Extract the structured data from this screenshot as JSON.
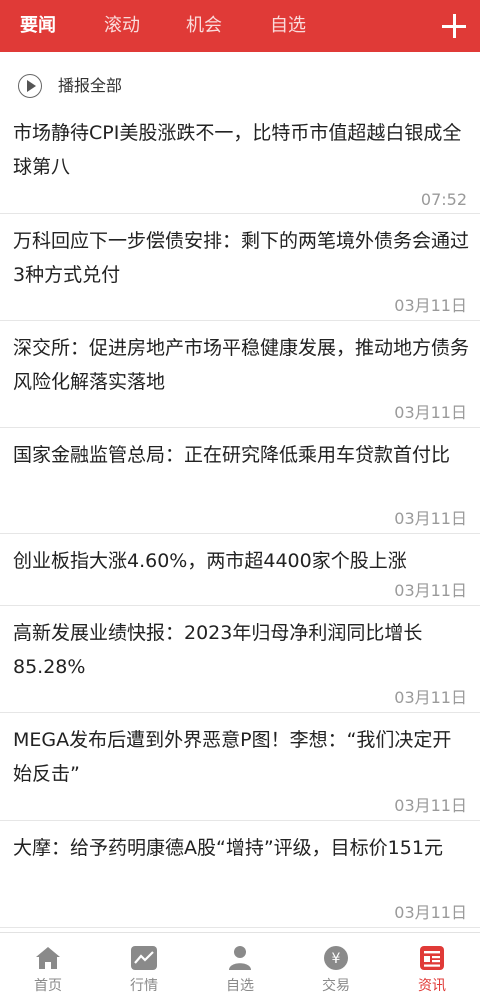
{
  "header": {
    "tabs": [
      {
        "label": "要闻",
        "active": true
      },
      {
        "label": "滚动",
        "active": false
      },
      {
        "label": "机会",
        "active": false
      },
      {
        "label": "自选",
        "active": false
      }
    ],
    "add_icon": "plus-icon"
  },
  "broadcast": {
    "icon": "play-icon",
    "label": "播报全部"
  },
  "news": [
    {
      "title": "市场静待CPI美股涨跌不一，比特币市值超越白银成全球第八",
      "time": "07:52"
    },
    {
      "title": "万科回应下一步偿债安排：剩下的两笔境外债务会通过3种方式兑付",
      "time": "03月11日"
    },
    {
      "title": "深交所：促进房地产市场平稳健康发展，推动地方债务风险化解落实落地",
      "time": "03月11日"
    },
    {
      "title": "国家金融监管总局：正在研究降低乘用车贷款首付比",
      "time": "03月11日"
    },
    {
      "title": "创业板指大涨4.60%，两市超4400家个股上涨",
      "time": "03月11日"
    },
    {
      "title": "高新发展业绩快报：2023年归母净利润同比增长85.28%",
      "time": "03月11日"
    },
    {
      "title": "MEGA发布后遭到外界恶意P图！李想：“我们决定开始反击”",
      "time": "03月11日"
    },
    {
      "title": "大摩：给予药明康德A股“增持”评级，目标价151元",
      "time": "03月11日"
    }
  ],
  "bottom_nav": [
    {
      "label": "首页",
      "icon": "home-icon",
      "active": false
    },
    {
      "label": "行情",
      "icon": "chart-icon",
      "active": false
    },
    {
      "label": "自选",
      "icon": "person-icon",
      "active": false
    },
    {
      "label": "交易",
      "icon": "yen-icon",
      "active": false
    },
    {
      "label": "资讯",
      "icon": "news-icon",
      "active": true
    }
  ],
  "colors": {
    "brand_red": "#e03a37",
    "gray_text": "#9a9a9a"
  }
}
